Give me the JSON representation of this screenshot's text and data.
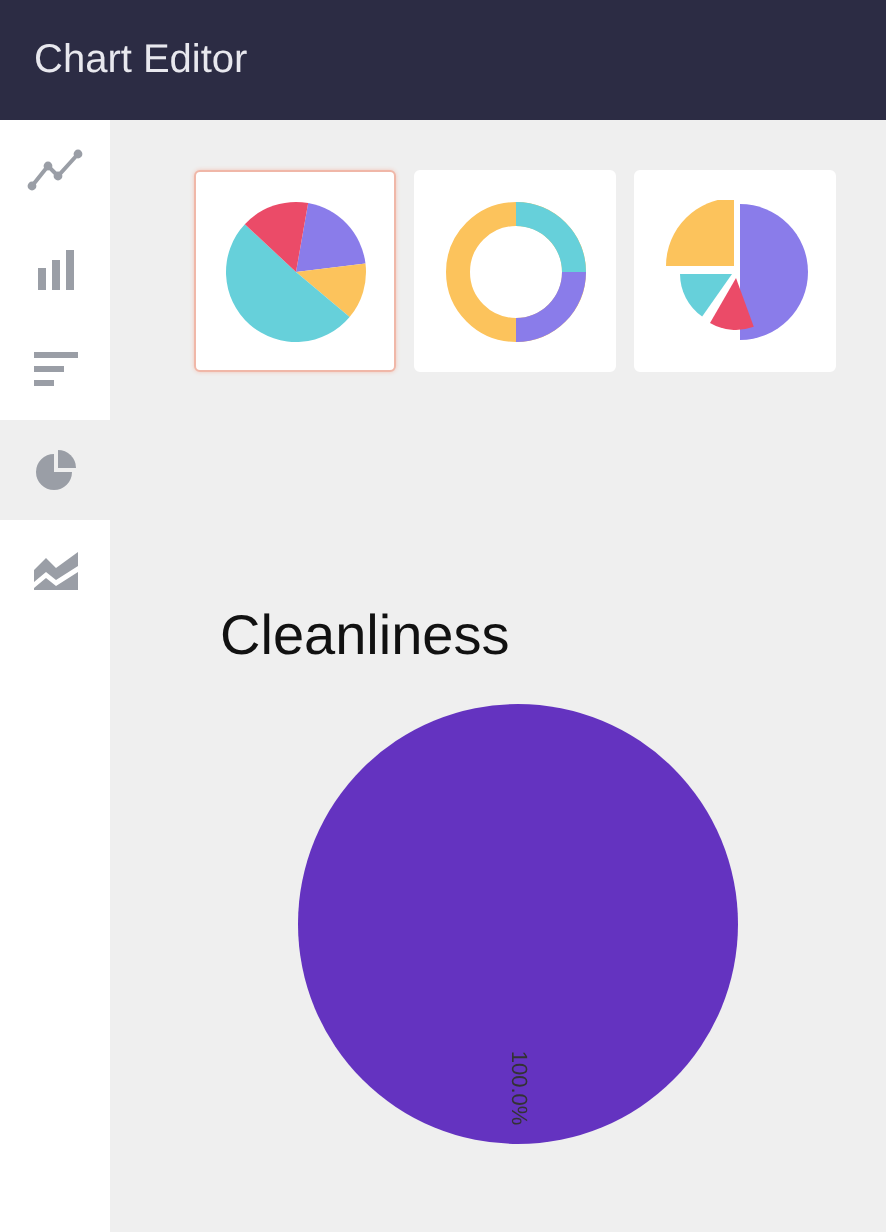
{
  "header": {
    "title": "Chart Editor"
  },
  "sidebar": {
    "items": [
      {
        "kind": "line",
        "selected": false
      },
      {
        "kind": "bar",
        "selected": false
      },
      {
        "kind": "hbar",
        "selected": false
      },
      {
        "kind": "pie",
        "selected": true
      },
      {
        "kind": "area",
        "selected": false
      }
    ]
  },
  "chart_types": [
    {
      "kind": "pie",
      "selected": true
    },
    {
      "kind": "donut",
      "selected": false
    },
    {
      "kind": "exploded",
      "selected": false
    }
  ],
  "chart": {
    "chart_data": {
      "type": "pie",
      "title": "Cleanliness",
      "series": [
        {
          "color": "#6433c0",
          "values": [
            100
          ]
        }
      ],
      "value_labels": [
        "100.0%"
      ]
    }
  }
}
